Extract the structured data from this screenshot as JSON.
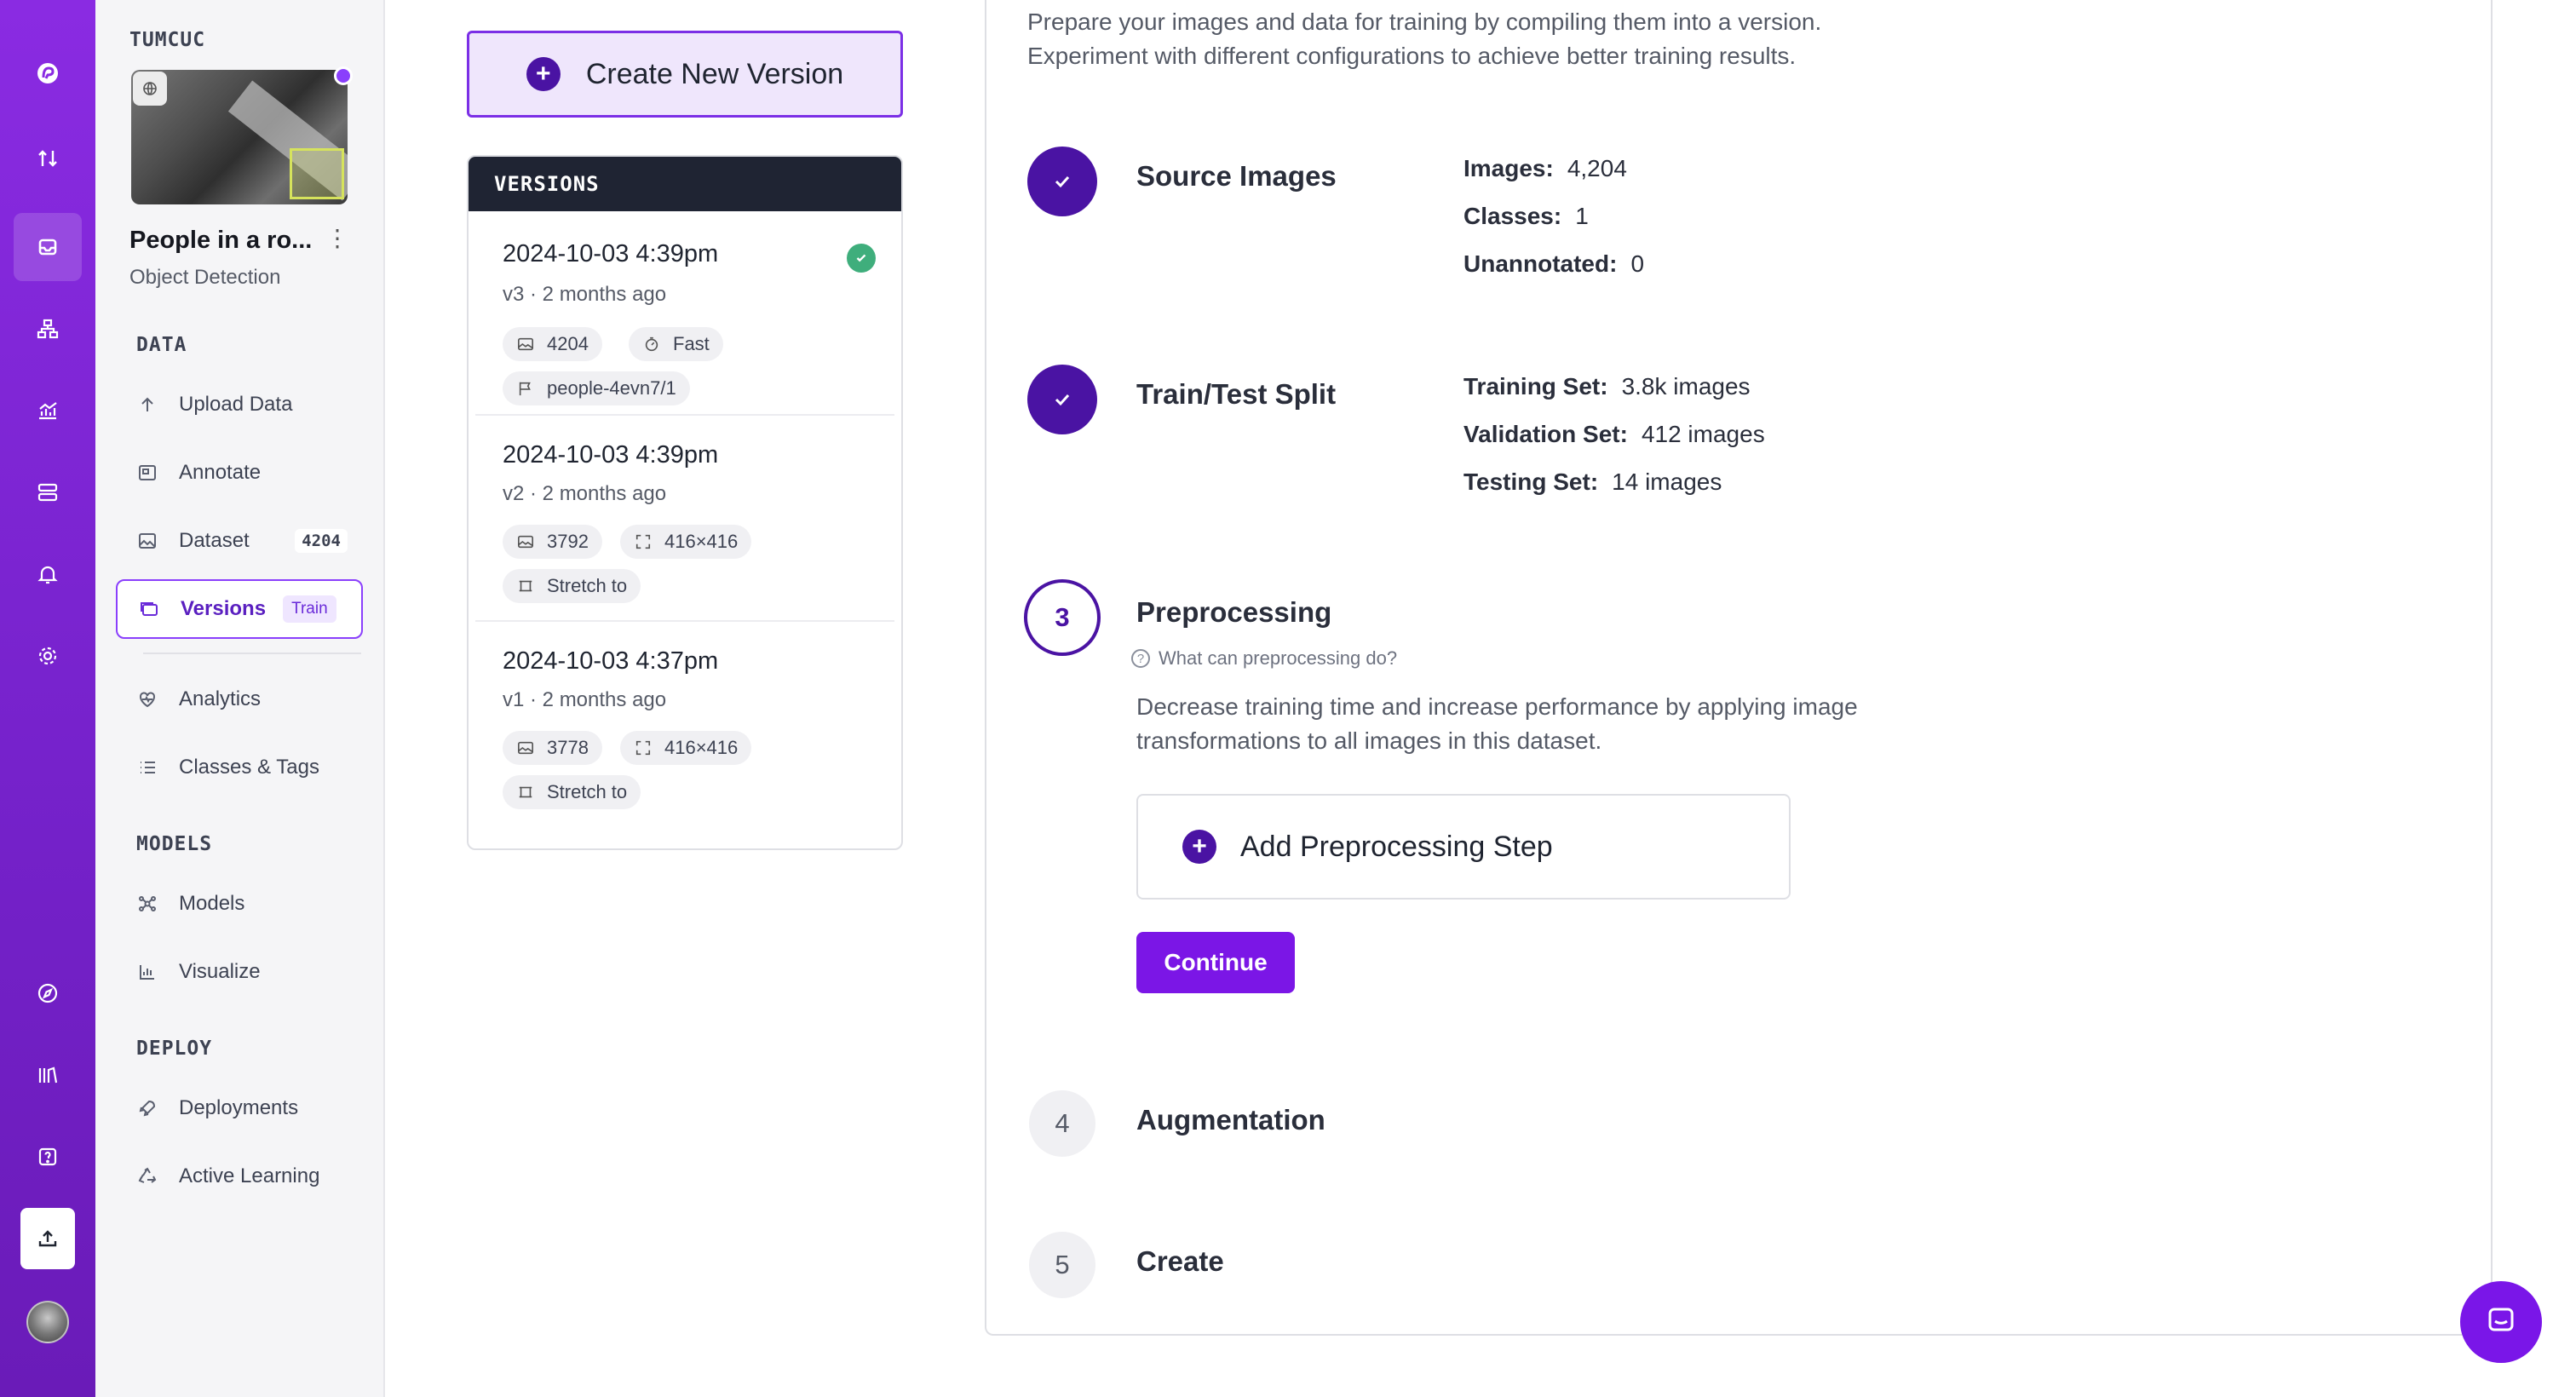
{
  "rail": {
    "items": [
      {
        "icon": "roboflow-logo-icon"
      },
      {
        "icon": "arrows-up-down-icon"
      },
      {
        "icon": "inbox-icon",
        "active": true
      },
      {
        "icon": "workflow-icon"
      },
      {
        "icon": "chart-icon"
      },
      {
        "icon": "server-icon"
      },
      {
        "icon": "bell-icon"
      },
      {
        "icon": "gear-icon"
      },
      {
        "icon": "compass-icon"
      },
      {
        "icon": "library-icon"
      },
      {
        "icon": "help-icon"
      },
      {
        "icon": "upload-icon"
      },
      {
        "icon": "avatar"
      }
    ]
  },
  "sidebar": {
    "workspace": "TUMCUC",
    "project_title": "People in a ro...",
    "project_type": "Object Detection",
    "sections": {
      "data": "DATA",
      "models": "MODELS",
      "deploy": "DEPLOY"
    },
    "items": {
      "upload": "Upload Data",
      "annotate": "Annotate",
      "dataset": "Dataset",
      "dataset_count": "4204",
      "versions": "Versions",
      "versions_badge": "Train",
      "analytics": "Analytics",
      "classes": "Classes & Tags",
      "models": "Models",
      "visualize": "Visualize",
      "deployments": "Deployments",
      "active_learning": "Active Learning"
    }
  },
  "versions": {
    "create_label": "Create New Version",
    "header": "VERSIONS",
    "list": [
      {
        "date": "2024-10-03 4:39pm",
        "sub": "v3 · 2 months ago",
        "chip1": "4204",
        "chip2": "Fast",
        "chip3": "people-4evn7/1",
        "status": "ready"
      },
      {
        "date": "2024-10-03 4:39pm",
        "sub": "v2 · 2 months ago",
        "chip1": "3792",
        "chip2": "416×416",
        "chip3": "Stretch to"
      },
      {
        "date": "2024-10-03 4:37pm",
        "sub": "v1 · 2 months ago",
        "chip1": "3778",
        "chip2": "416×416",
        "chip3": "Stretch to"
      }
    ]
  },
  "main": {
    "intro_line1": "Prepare your images and data for training by compiling them into a version.",
    "intro_line2": "Experiment with different configurations to achieve better training results.",
    "steps": {
      "source": {
        "title": "Source Images",
        "images_label": "Images:",
        "images_value": "4,204",
        "classes_label": "Classes:",
        "classes_value": "1",
        "unannotated_label": "Unannotated:",
        "unannotated_value": "0"
      },
      "split": {
        "title": "Train/Test Split",
        "training_label": "Training Set:",
        "training_value": "3.8k images",
        "validation_label": "Validation Set:",
        "validation_value": "412 images",
        "testing_label": "Testing Set:",
        "testing_value": "14 images"
      },
      "preprocessing": {
        "number": "3",
        "title": "Preprocessing",
        "help": "What can preprocessing do?",
        "desc_line1": "Decrease training time and increase performance by applying image",
        "desc_line2": "transformations to all images in this dataset.",
        "add_label": "Add Preprocessing Step",
        "continue_label": "Continue"
      },
      "augmentation": {
        "number": "4",
        "title": "Augmentation"
      },
      "create": {
        "number": "5",
        "title": "Create"
      }
    }
  },
  "colors": {
    "brand": "#8a2be2",
    "primary_dark": "#4a13a3",
    "button": "#7b16e6",
    "success": "#3fae7c"
  }
}
